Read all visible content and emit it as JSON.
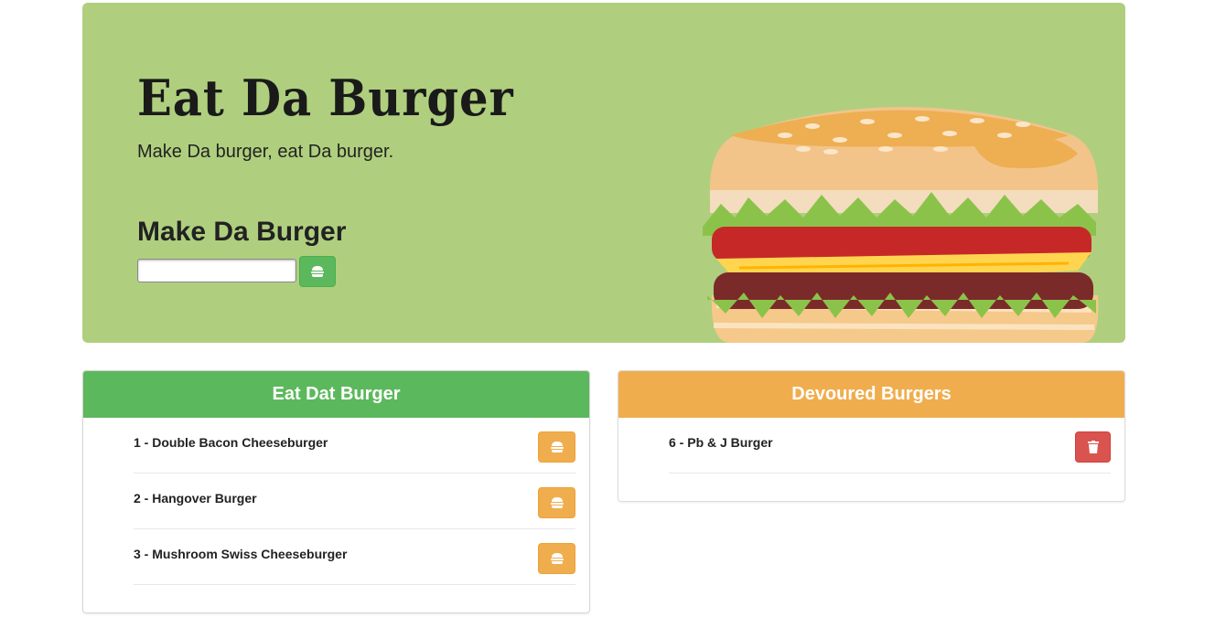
{
  "header": {
    "title": "Eat Da Burger",
    "subtitle": "Make Da burger, eat Da burger.",
    "form_label": "Make Da Burger",
    "input_value": "",
    "add_button_icon": "burger-icon"
  },
  "eat_panel": {
    "heading": "Eat Dat Burger",
    "heading_color": "#5cb85c",
    "items": [
      {
        "text": "1 - Double Bacon Cheeseburger",
        "icon": "burger-icon"
      },
      {
        "text": "2 - Hangover Burger",
        "icon": "burger-icon"
      },
      {
        "text": "3 - Mushroom Swiss Cheeseburger",
        "icon": "burger-icon"
      }
    ]
  },
  "devoured_panel": {
    "heading": "Devoured Burgers",
    "heading_color": "#f0ad4e",
    "items": [
      {
        "text": "6 - Pb & J Burger",
        "icon": "trash-icon"
      }
    ]
  },
  "colors": {
    "jumbotron_bg": "#afcf7e",
    "success": "#5cb85c",
    "warning": "#f0ad4e",
    "danger": "#d9534f"
  }
}
